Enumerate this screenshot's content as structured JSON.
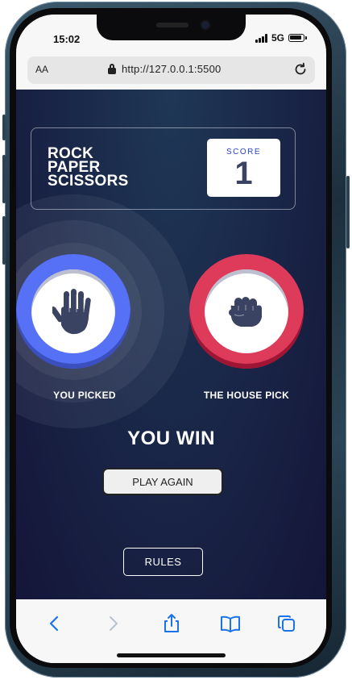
{
  "status": {
    "time": "15:02",
    "network": "5G"
  },
  "browser": {
    "text_size_label": "AA",
    "url": "http://127.0.0.1:5500"
  },
  "game": {
    "title_lines": [
      "ROCK",
      "PAPER",
      "SCISSORS"
    ],
    "score_label": "SCORE",
    "score_value": "1",
    "player_label": "YOU PICKED",
    "house_label": "THE HOUSE PICK",
    "player_pick": "paper",
    "house_pick": "rock",
    "result": "YOU WIN",
    "play_again_label": "PLAY AGAIN",
    "rules_label": "RULES"
  },
  "colors": {
    "paper_ring": "#5671f5",
    "rock_ring": "#de3a5a",
    "icon_fill": "#3b4363",
    "score_label": "#2a46c0",
    "safari_blue": "#1a73e8"
  },
  "toolbar": {
    "icons": [
      "back-icon",
      "forward-icon",
      "share-icon",
      "bookmarks-icon",
      "tabs-icon"
    ]
  }
}
